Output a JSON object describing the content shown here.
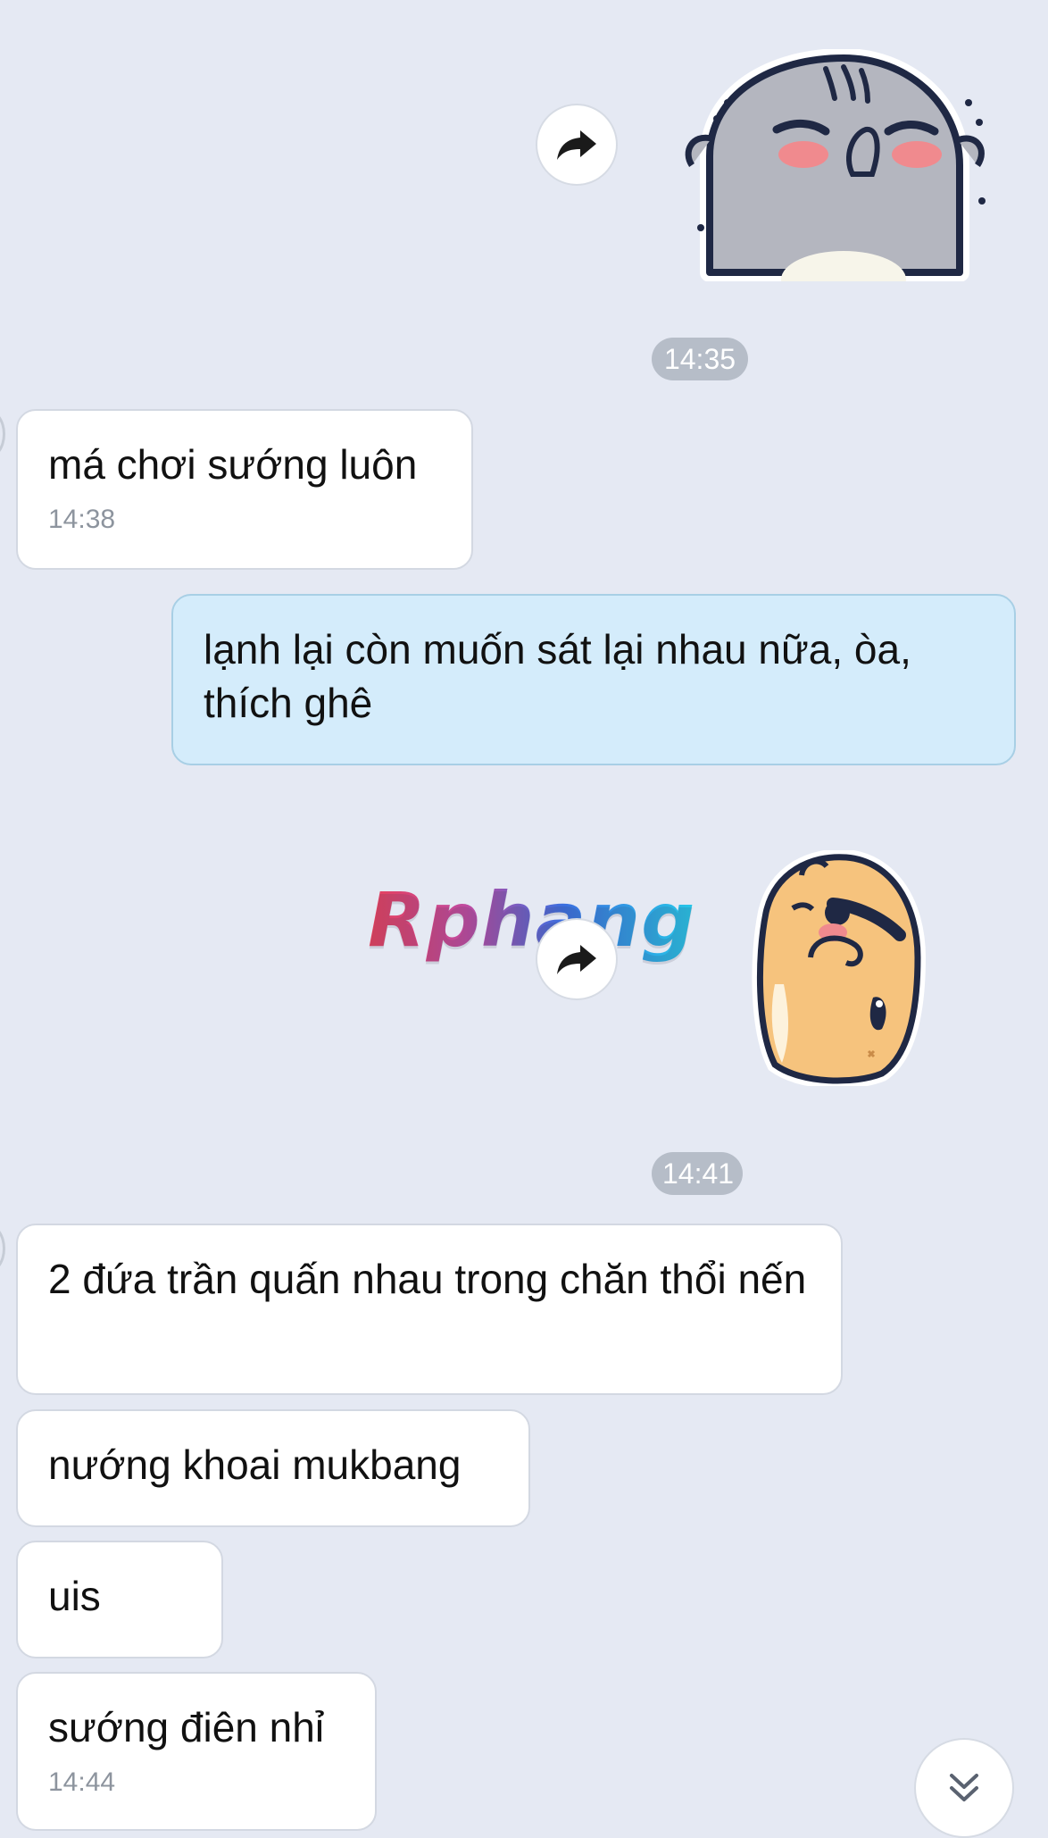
{
  "messages": {
    "msg1": {
      "text": "má chơi sướng luôn",
      "time": "14:38"
    },
    "msg2": {
      "text": "lạnh lại còn muốn sát lại nhau nữa, òa, thích ghê"
    },
    "msg3": {
      "text": "2 đứa trần quấn nhau trong chăn thổi nến"
    },
    "msg4": {
      "text": "nướng khoai mukbang"
    },
    "msg5": {
      "text": "uis"
    },
    "msg6": {
      "text": "sướng điên nhỉ",
      "time": "14:44"
    }
  },
  "timestamps": {
    "t1": "14:35",
    "t2": "14:41"
  },
  "watermark": "Rphang",
  "icons": {
    "forward": "forward-arrow-icon",
    "scroll_down": "double-chevron-down-icon"
  },
  "colors": {
    "background": "#e5e9f3",
    "outgoing_bubble": "#d4ecfb",
    "incoming_bubble": "#ffffff",
    "time_pill": "#b6bdc8"
  }
}
